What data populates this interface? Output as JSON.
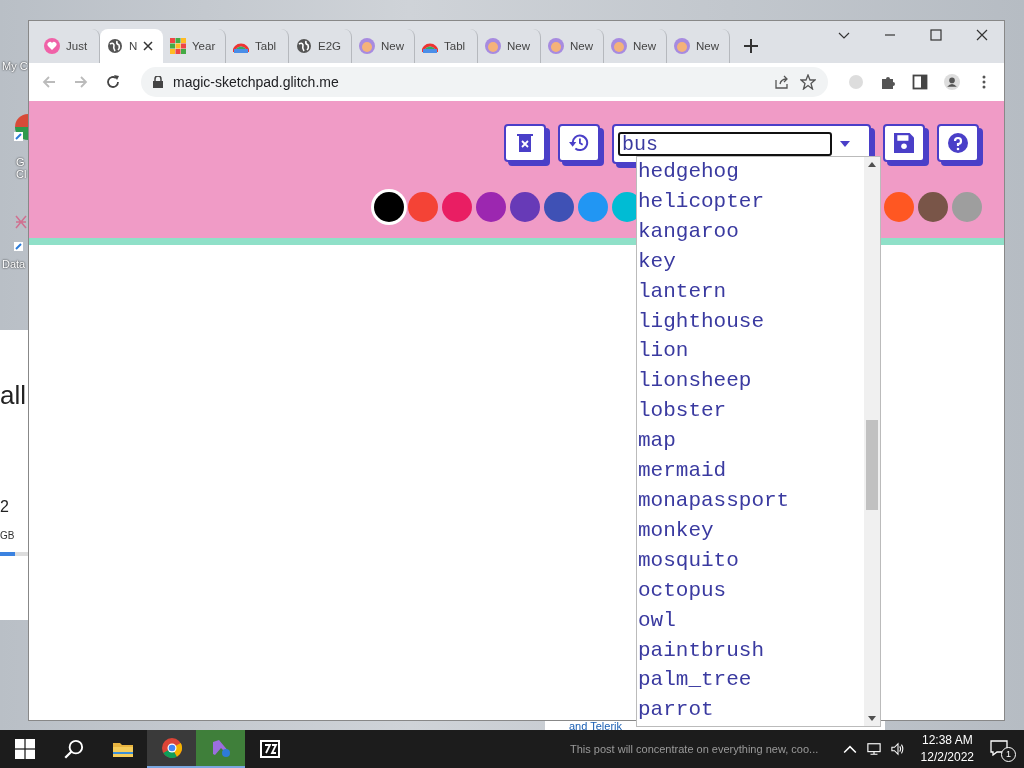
{
  "desktop": {
    "icons": [
      {
        "label": "My C"
      },
      {
        "label": "G\nCl"
      },
      {
        "label": "Data"
      }
    ]
  },
  "background_window": {
    "heading": "all",
    "value": "2",
    "unit": "GB",
    "usage": {
      "level": 0.55
    }
  },
  "behind_text": {
    "link": "and Telerik",
    "snippet": "This post will concentrate on everything new, coo..."
  },
  "browser": {
    "tabs": [
      {
        "title": "Just",
        "kind": "heart",
        "selected": false
      },
      {
        "title": "N",
        "kind": "globe",
        "selected": true
      },
      {
        "title": "Year",
        "kind": "grid",
        "selected": false
      },
      {
        "title": "Tabl",
        "kind": "rainbow",
        "selected": false
      },
      {
        "title": "E2G",
        "kind": "globe",
        "selected": false
      },
      {
        "title": "New",
        "kind": "face",
        "selected": false
      },
      {
        "title": "Tabl",
        "kind": "rainbow",
        "selected": false
      },
      {
        "title": "New",
        "kind": "face",
        "selected": false
      },
      {
        "title": "New",
        "kind": "face",
        "selected": false
      },
      {
        "title": "New",
        "kind": "face",
        "selected": false
      },
      {
        "title": "New",
        "kind": "face",
        "selected": false
      }
    ],
    "address": "magic-sketchpad.glitch.me"
  },
  "sketchpad": {
    "search": {
      "value": "bus"
    },
    "palette_left": [
      {
        "color": "#000000",
        "selected": true
      },
      {
        "color": "#f44336",
        "selected": false
      },
      {
        "color": "#e91e63",
        "selected": false
      },
      {
        "color": "#9c27b0",
        "selected": false
      },
      {
        "color": "#673ab7",
        "selected": false
      },
      {
        "color": "#3f51b5",
        "selected": false
      },
      {
        "color": "#2196f3",
        "selected": false
      },
      {
        "color": "#00bcd4",
        "selected": false
      }
    ],
    "palette_right": [
      {
        "color": "#ff5722",
        "selected": false
      },
      {
        "color": "#795548",
        "selected": false
      },
      {
        "color": "#9e9e9e",
        "selected": false
      }
    ],
    "suggestions": [
      "hedgehog",
      "helicopter",
      "kangaroo",
      "key",
      "lantern",
      "lighthouse",
      "lion",
      "lionsheep",
      "lobster",
      "map",
      "mermaid",
      "monapassport",
      "monkey",
      "mosquito",
      "octopus",
      "owl",
      "paintbrush",
      "palm_tree",
      "parrot"
    ]
  },
  "taskbar": {
    "apps": [
      {
        "kind": "start",
        "active": false
      },
      {
        "kind": "search",
        "active": false
      },
      {
        "kind": "folder",
        "active": false
      },
      {
        "kind": "chrome",
        "active": true
      },
      {
        "kind": "vs",
        "active": true
      },
      {
        "kind": "zip",
        "active": false
      }
    ],
    "time": "12:38 AM",
    "date": "12/2/2022",
    "notifications": "1"
  }
}
